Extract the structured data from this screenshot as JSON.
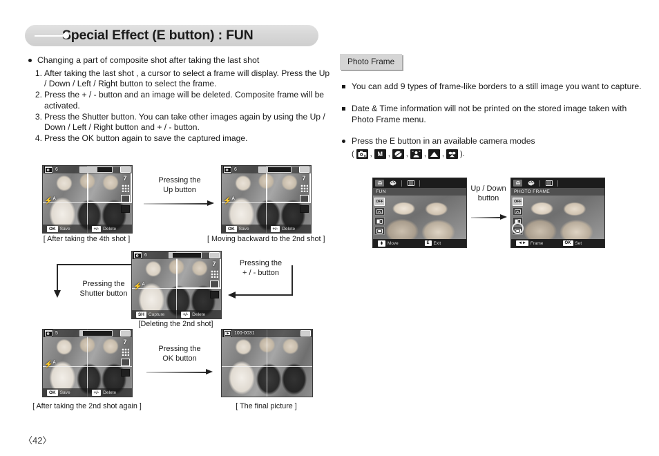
{
  "header": {
    "title": "Special Effect (E button) : FUN"
  },
  "left": {
    "intro": "Changing a part of composite shot after taking the last shot",
    "steps": [
      {
        "num": "1.",
        "text": "After taking the last shot , a cursor to select a frame will display. Press the Up / Down / Left / Right button to select the frame."
      },
      {
        "num": "2.",
        "text": "Press the + / - button and an image will be deleted. Composite frame will be activated."
      },
      {
        "num": "3.",
        "text": "Press the Shutter button. You can take other images again by using the Up / Down / Left / Right button and + / - button."
      },
      {
        "num": "4.",
        "text": "Press the OK button again to save the captured image."
      }
    ],
    "captions": {
      "shot4": "[ After taking the 4th shot ]",
      "back2nd": "[ Moving backward to the 2nd shot ]",
      "delete2nd": "[Deleting the 2nd shot]",
      "shot2again": "[ After taking the 2nd shot again ]",
      "final": "[ The final picture ]"
    },
    "arrows": {
      "up": {
        "line1": "Pressing the",
        "line2": "Up button"
      },
      "shutter": {
        "line1": "Pressing the",
        "line2": "Shutter button"
      },
      "plusminus": {
        "line1": "Pressing the",
        "line2": "+ / - button"
      },
      "ok": {
        "line1": "Pressing the",
        "line2": "OK button"
      }
    },
    "lcd": {
      "shots_count": "6",
      "shots_count_alt": "5",
      "save_key": "OK",
      "save_label": "Save",
      "delete_key": "+/-",
      "delete_label": "Delete",
      "capture_key": "SH",
      "capture_label": "Capture",
      "resolution": "7",
      "flash": "A",
      "file_number": "100-0031"
    }
  },
  "right": {
    "tag": "Photo Frame",
    "bullets": [
      "You can add 9 types of frame-like borders to a still image you want to capture.",
      "Date & Time information will not be printed on the stored image taken with Photo Frame menu."
    ],
    "modes_intro": "Press the E button in an available camera modes",
    "modes_open": "(",
    "modes_close": ").",
    "modes": [
      {
        "name": "program-mode-icon",
        "glyph": ""
      },
      {
        "name": "manual-mode-icon",
        "glyph": "M"
      },
      {
        "name": "night-mode-icon",
        "glyph": ""
      },
      {
        "name": "portrait-mode-icon",
        "glyph": ""
      },
      {
        "name": "landscape-mode-icon",
        "glyph": ""
      },
      {
        "name": "macro-mode-icon",
        "glyph": ""
      }
    ],
    "arrow": {
      "line1": "Up / Down",
      "line2": "button"
    },
    "menu_left": {
      "title": "FUN",
      "items": [
        "OFF",
        "",
        "",
        ""
      ],
      "bottom_key": "E",
      "bottom_key_label": "Exit",
      "move_label": "Move"
    },
    "menu_right": {
      "title": "PHOTO FRAME",
      "items": [
        "OFF",
        "",
        "",
        ""
      ],
      "frame_label": "Frame",
      "set_key": "OK",
      "set_label": "Set"
    }
  },
  "footer": {
    "page": "〈42〉"
  }
}
